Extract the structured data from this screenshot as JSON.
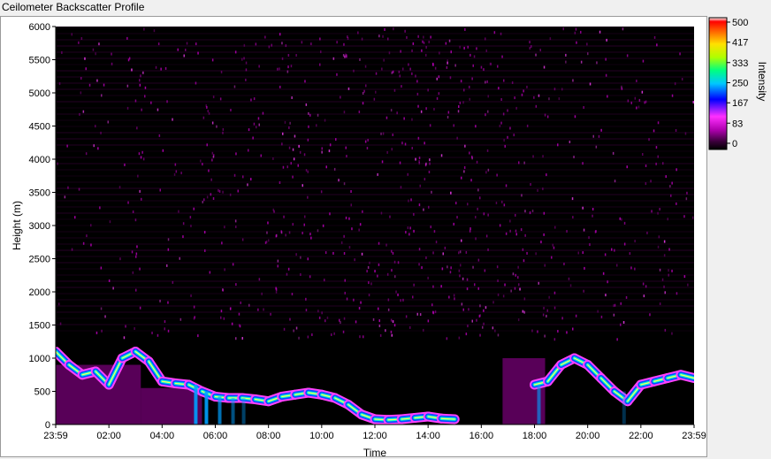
{
  "window": {
    "title": "Ceilometer Backscatter Profile"
  },
  "chart_data": {
    "type": "heatmap",
    "title": "Ceilometer Backscatter Profile",
    "xlabel": "Time",
    "ylabel": "Height (m)",
    "ylim": [
      0,
      6000
    ],
    "xlim": [
      "23:59",
      "23:59"
    ],
    "x_ticks": [
      "23:59",
      "02:00",
      "04:00",
      "06:00",
      "08:00",
      "10:00",
      "12:00",
      "14:00",
      "16:00",
      "18:00",
      "20:00",
      "22:00",
      "23:59"
    ],
    "y_ticks": [
      0,
      500,
      1000,
      1500,
      2000,
      2500,
      3000,
      3500,
      4000,
      4500,
      5000,
      5500,
      6000
    ],
    "colorbar": {
      "label": "Intensity",
      "range": [
        0,
        500
      ],
      "ticks": [
        500,
        417,
        333,
        250,
        167,
        83,
        0
      ],
      "colors": [
        "#000000",
        "#5a005a",
        "#c000c0",
        "#ff40ff",
        "#0000ff",
        "#00ffff",
        "#00ff00",
        "#ffff00",
        "#ff8000",
        "#ff0000",
        "#ffffff"
      ]
    },
    "cloud_base_series": {
      "name": "",
      "hours": [
        0.0,
        0.5,
        1.0,
        1.5,
        2.0,
        2.5,
        3.0,
        3.5,
        4.0,
        4.5,
        5.0,
        5.5,
        6.0,
        6.5,
        7.0,
        7.5,
        8.0,
        8.5,
        9.0,
        9.5,
        10.0,
        10.5,
        11.0,
        11.5,
        12.0,
        12.5,
        13.0,
        13.5,
        14.0,
        14.5,
        15.0,
        18.0,
        18.5,
        19.0,
        19.5,
        20.0,
        20.5,
        21.0,
        21.5,
        22.0,
        22.5,
        23.0,
        23.5,
        24.0
      ],
      "height_m": [
        1100,
        900,
        750,
        800,
        600,
        1000,
        1100,
        950,
        650,
        620,
        600,
        500,
        420,
        400,
        400,
        380,
        350,
        420,
        450,
        480,
        450,
        400,
        300,
        150,
        80,
        70,
        80,
        100,
        120,
        90,
        80,
        600,
        650,
        900,
        1000,
        900,
        700,
        500,
        350,
        600,
        650,
        700,
        750,
        700
      ]
    },
    "grid": false,
    "legend": "colorbar-right"
  }
}
